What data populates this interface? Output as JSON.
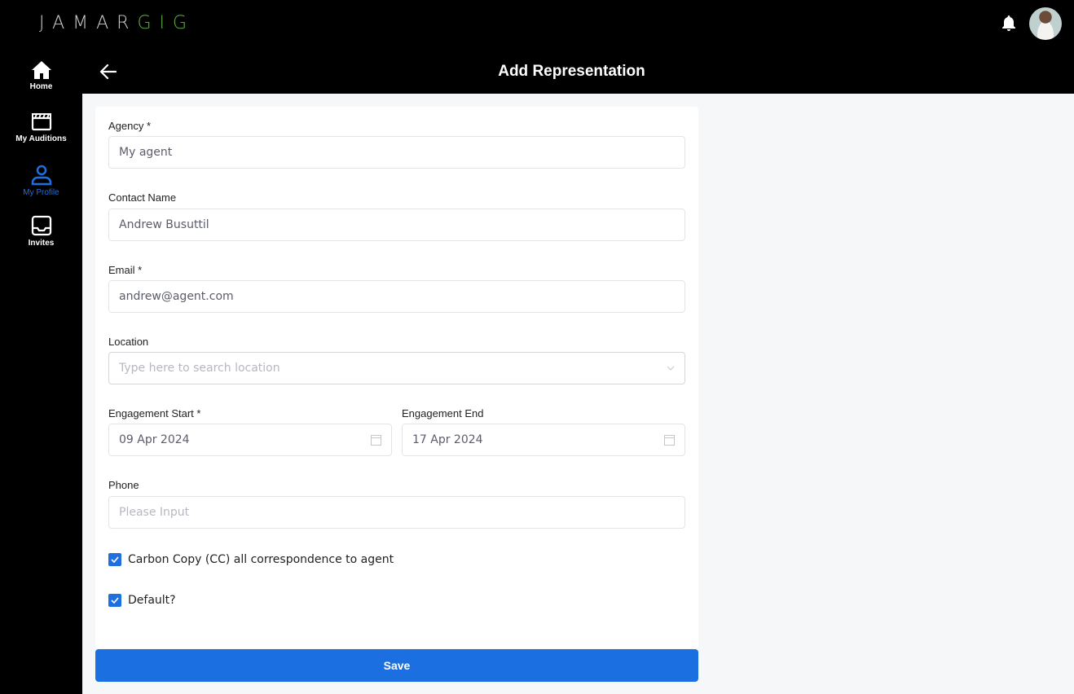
{
  "app": {
    "logo_part1": "JAMAR",
    "logo_part2": "GIG",
    "brand_green": "#5fb043",
    "accent_blue": "#1e6fe0"
  },
  "sidebar": {
    "items": [
      {
        "label": "Home",
        "icon": "home-icon",
        "active": false
      },
      {
        "label": "My Auditions",
        "icon": "clapperboard-icon",
        "active": false
      },
      {
        "label": "My Profile",
        "icon": "user-icon",
        "active": true
      },
      {
        "label": "Invites",
        "icon": "inbox-icon",
        "active": false
      }
    ]
  },
  "header": {
    "title": "Add Representation"
  },
  "form": {
    "agency": {
      "label": "Agency *",
      "value": "My agent"
    },
    "contact_name": {
      "label": "Contact Name",
      "value": "Andrew Busuttil"
    },
    "email": {
      "label": "Email *",
      "value": "andrew@agent.com"
    },
    "location": {
      "label": "Location",
      "placeholder": "Type here to search location"
    },
    "engagement_start": {
      "label": "Engagement Start *",
      "value": "09 Apr 2024"
    },
    "engagement_end": {
      "label": "Engagement End",
      "value": "17 Apr 2024"
    },
    "phone": {
      "label": "Phone",
      "placeholder": "Please Input"
    },
    "cc_checkbox": {
      "label": "Carbon Copy (CC) all correspondence to agent",
      "checked": true
    },
    "default_checkbox": {
      "label": "Default?",
      "checked": true
    },
    "save_label": "Save"
  }
}
